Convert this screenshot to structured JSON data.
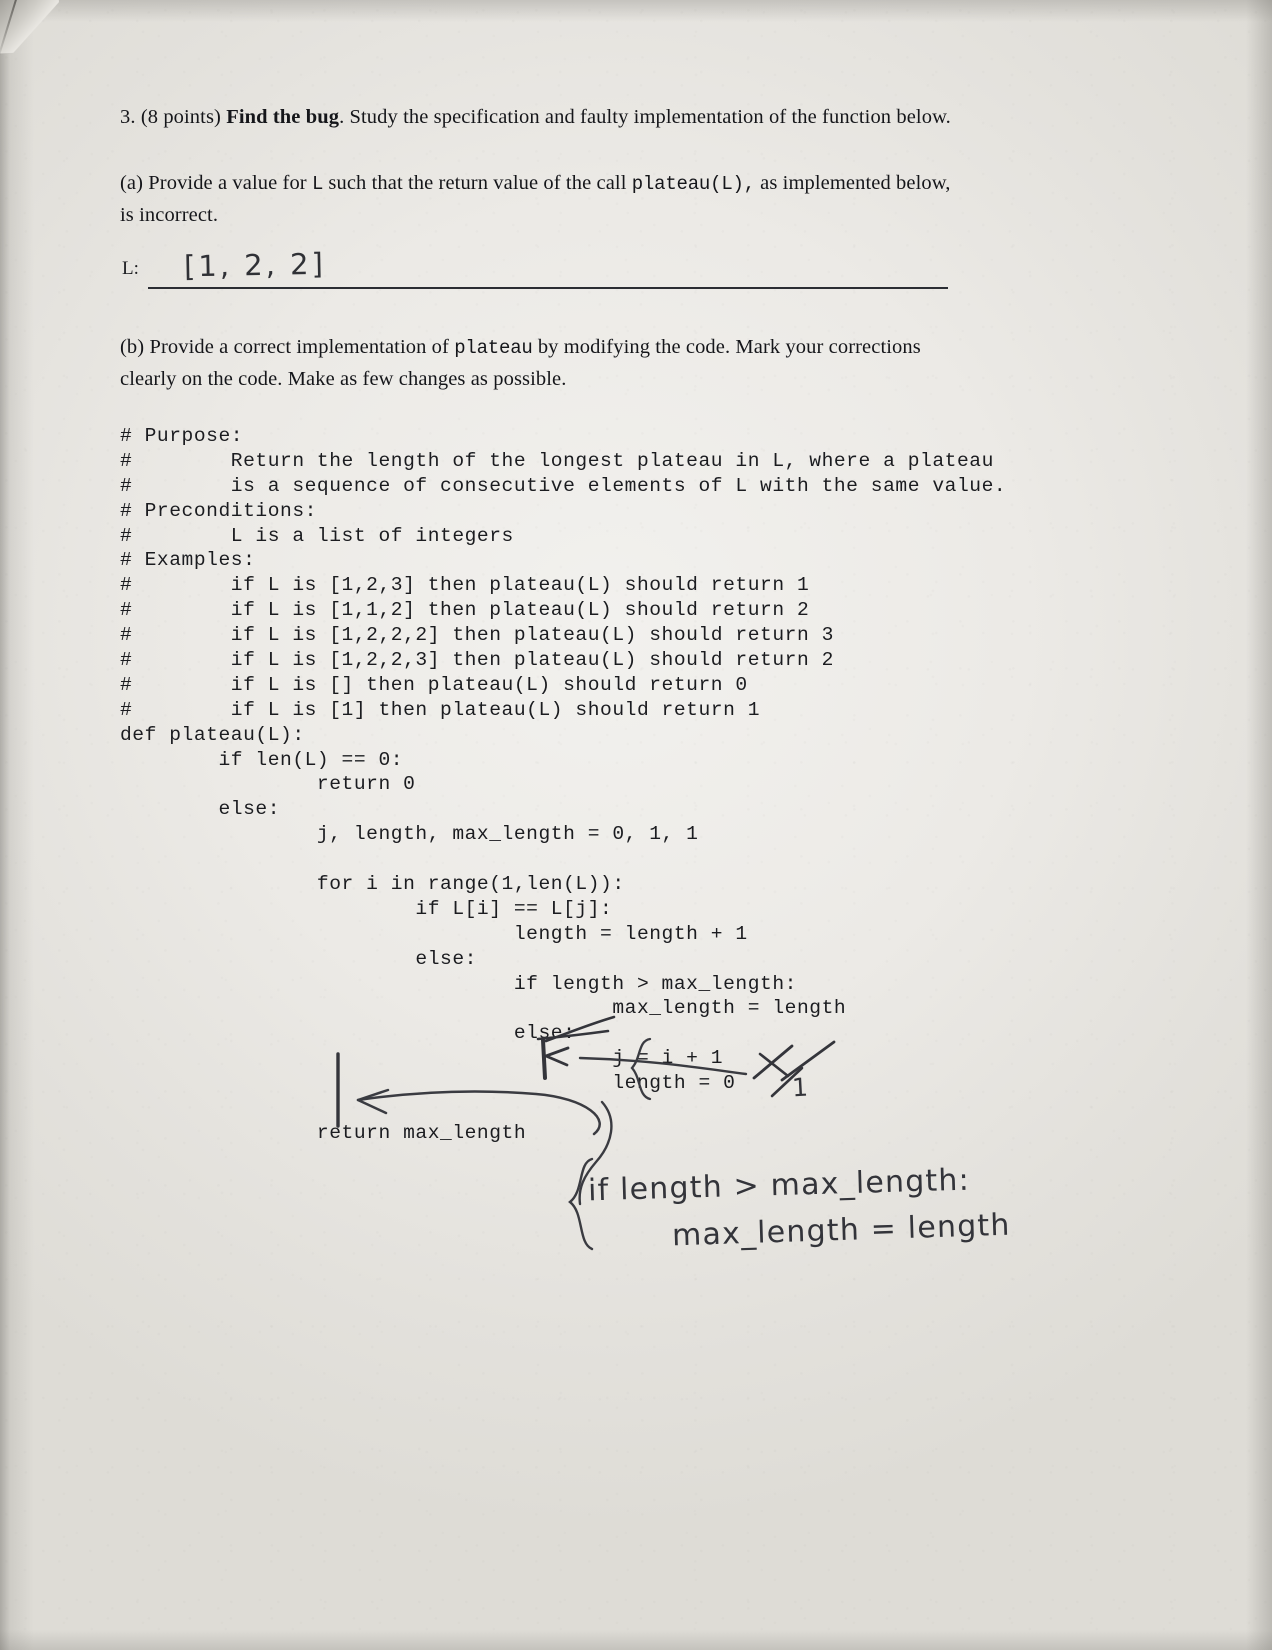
{
  "document": {
    "kind": "scanned-exam-page",
    "question_number": "3.",
    "points": "(8 points)",
    "title": "Find the bug",
    "intro": ". Study the specification and faulty implementation of the function below.",
    "ink_color": "#2a2b30",
    "print_color": "#15161a",
    "paper_color": "#ece9e4"
  },
  "part_a": {
    "label": "(a)",
    "text_before": " Provide a value for ",
    "mono_1": "L",
    "text_mid": " such that the return value of the call ",
    "mono_2": "plateau(L),",
    "text_after": " as implemented below,",
    "line2": "is incorrect.",
    "answer_field_label": "L:",
    "answer_handwritten": "[1, 2, 2]"
  },
  "part_b": {
    "label": "(b)",
    "text_before": " Provide a correct implementation of ",
    "mono_1": "plateau",
    "text_after": " by modifying the code. Mark your corrections",
    "line2": "clearly on the code. Make as few changes as possible."
  },
  "code": {
    "language": "python",
    "lines": [
      "# Purpose:",
      "#        Return the length of the longest plateau in L, where a plateau",
      "#        is a sequence of consecutive elements of L with the same value.",
      "# Preconditions:",
      "#        L is a list of integers",
      "# Examples:",
      "#        if L is [1,2,3] then plateau(L) should return 1",
      "#        if L is [1,1,2] then plateau(L) should return 2",
      "#        if L is [1,2,2,2] then plateau(L) should return 3",
      "#        if L is [1,2,2,3] then plateau(L) should return 2",
      "#        if L is [] then plateau(L) should return 0",
      "#        if L is [1] then plateau(L) should return 1",
      "def plateau(L):",
      "        if len(L) == 0:",
      "                return 0",
      "        else:",
      "                j, length, max_length = 0, 1, 1",
      "",
      "                for i in range(1,len(L)):",
      "                        if L[i] == L[j]:",
      "                                length = length + 1",
      "                        else:",
      "                                if length > max_length:",
      "                                        max_length = length",
      "                                else:",
      "                                        j = i + 1",
      "                                        length = 0",
      "",
      "                return max_length"
    ]
  },
  "annotations": {
    "strike_else": "else:",
    "strike_plus_one": "+ 1",
    "strike_zero": "0",
    "inserted_one": "1",
    "correction_line_1": "if length > max_length:",
    "correction_line_2": "max_length = length",
    "marks": [
      "strikethrough-else",
      "strikethrough-plus-one",
      "strikethrough-zero",
      "inserted-digit-one",
      "dedent-arrow-to-return",
      "dedent-arrow-to-else-block",
      "indent-bar-left",
      "brace-around-j-length",
      "brace-around-correction"
    ]
  }
}
